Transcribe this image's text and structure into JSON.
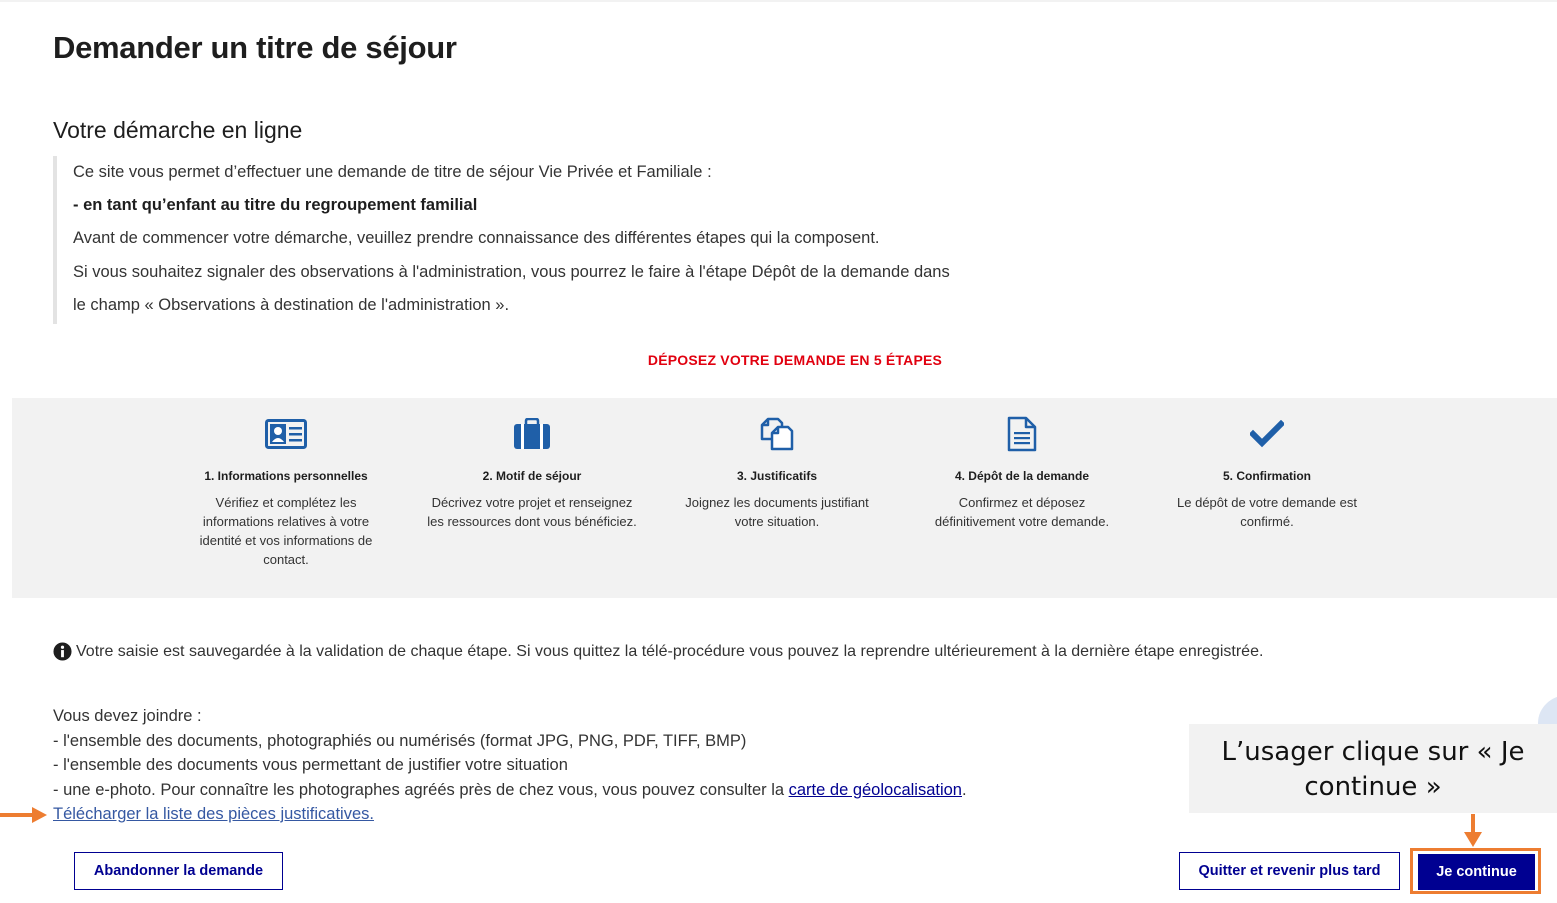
{
  "page": {
    "title": "Demander un titre de séjour",
    "section_title": "Votre démarche en ligne"
  },
  "intro": {
    "line1": "Ce site vous permet d’effectuer une demande de titre de séjour Vie Privée et Familiale :",
    "line2": "- en tant qu’enfant au titre du regroupement familial",
    "line3": "Avant de commencer votre démarche, veuillez prendre connaissance des différentes étapes qui la composent.",
    "line4": "Si vous souhaitez signaler des observations à l'administration, vous pourrez le faire à l'étape Dépôt de la demande dans",
    "line5": "le champ « Observations à destination de l'administration »."
  },
  "steps_title": "DÉPOSEZ VOTRE DEMANDE EN 5 ÉTAPES",
  "steps": [
    {
      "icon": "id-card-icon",
      "label": "1. Informations personnelles",
      "description": "Vérifiez et complétez les informations relatives à votre identité et vos informations de contact."
    },
    {
      "icon": "briefcase-icon",
      "label": "2. Motif de séjour",
      "description": "Décrivez votre projet et renseignez les ressources dont vous bénéficiez."
    },
    {
      "icon": "copy-documents-icon",
      "label": "3. Justificatifs",
      "description": "Joignez les documents justifiant votre situation."
    },
    {
      "icon": "document-icon",
      "label": "4. Dépôt de la demande",
      "description": "Confirmez et déposez définitivement votre demande."
    },
    {
      "icon": "checkmark-icon",
      "label": "5. Confirmation",
      "description": "Le dépôt de votre demande est confirmé."
    }
  ],
  "info_text": "Votre saisie est sauvegardée à la validation de chaque étape. Si vous quittez la télé-procédure vous pouvez la reprendre ultérieurement à la dernière étape enregistrée.",
  "joindre": {
    "heading": "Vous devez joindre :",
    "item1": "- l'ensemble des documents, photographiés ou numérisés (format JPG, PNG, PDF, TIFF, BMP)",
    "item2": "- l'ensemble des documents vous permettant de justifier votre situation",
    "item3_prefix": "- une e-photo. Pour connaître les photographes agréés près de chez vous, vous pouvez consulter la ",
    "item3_link": "carte de géolocalisation",
    "item3_suffix": ".",
    "download_link": "Télécharger la liste des pièces justificatives."
  },
  "callout_text": "L’usager clique sur « Je continue »",
  "buttons": {
    "abandon": "Abandonner la demande",
    "quit": "Quitter et revenir plus tard",
    "continue": "Je continue"
  },
  "colors": {
    "primary": "#000091",
    "accent_red": "#e1000f",
    "highlight_orange": "#ed7d31",
    "panel_gray": "#f2f2f2",
    "icon_blue": "#1f5fa8"
  }
}
